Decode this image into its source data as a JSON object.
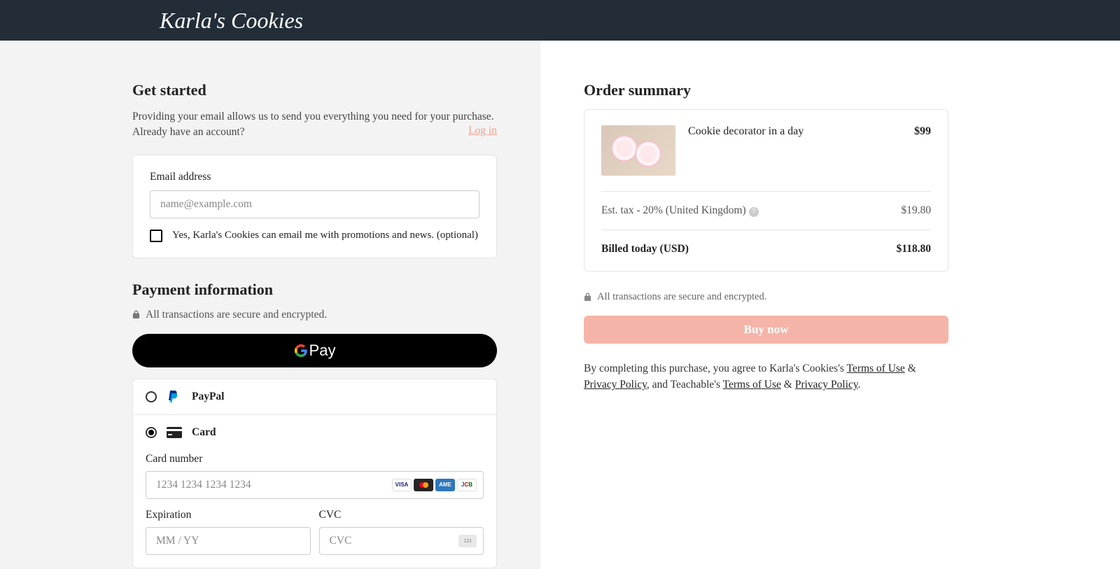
{
  "header": {
    "logo": "Karla's Cookies"
  },
  "getStarted": {
    "title": "Get started",
    "subtext": "Providing your email allows us to send you everything you need for your purchase. Already have an account?",
    "loginLink": "Log in",
    "emailLabel": "Email address",
    "emailPlaceholder": "name@example.com",
    "optinLabel": "Yes, Karla's Cookies can email me with promotions and news. (optional)"
  },
  "payment": {
    "title": "Payment information",
    "secureText": "All transactions are secure and encrypted.",
    "gpay": "Pay",
    "methods": {
      "paypal": "PayPal",
      "card": "Card"
    },
    "card": {
      "numberLabel": "Card number",
      "numberPlaceholder": "1234 1234 1234 1234",
      "expLabel": "Expiration",
      "expPlaceholder": "MM / YY",
      "cvcLabel": "CVC",
      "cvcPlaceholder": "CVC"
    }
  },
  "order": {
    "title": "Order summary",
    "product": {
      "name": "Cookie decorator in a day",
      "price": "$99"
    },
    "tax": {
      "label": "Est. tax - 20% (United Kingdom)",
      "amount": "$19.80"
    },
    "total": {
      "label": "Billed today (USD)",
      "amount": "$118.80"
    },
    "secureText": "All transactions are secure and encrypted.",
    "buyButton": "Buy now",
    "legal": {
      "prefix": "By completing this purchase, you agree to Karla's Cookies's ",
      "terms1": "Terms of Use",
      "amp": " & ",
      "privacy1": "Privacy Policy",
      "mid": ", and Teachable's ",
      "terms2": "Terms of Use",
      "amp2": " & ",
      "privacy2": "Privacy Policy",
      "end": "."
    }
  }
}
